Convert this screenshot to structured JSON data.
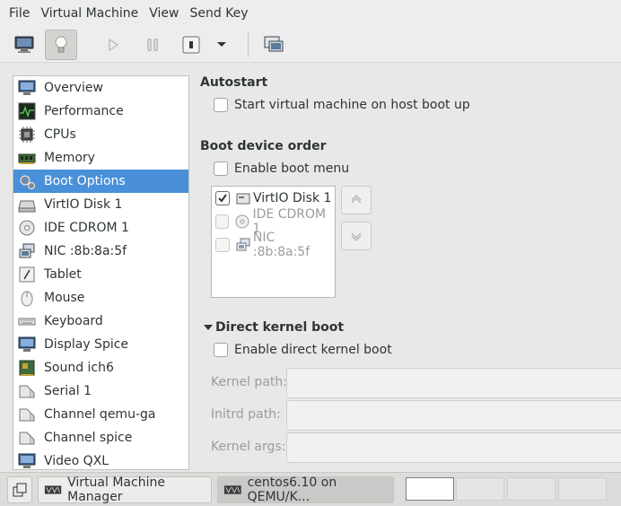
{
  "menubar": {
    "items": [
      "File",
      "Virtual Machine",
      "View",
      "Send Key"
    ]
  },
  "toolbar": {
    "buttons": [
      "monitor-icon",
      "lightbulb-icon",
      "play-icon",
      "pause-icon",
      "shutdown-icon",
      "chevron-down-icon",
      "screenshot-icon"
    ]
  },
  "sidebar": {
    "items": [
      {
        "label": "Overview",
        "icon": "overview-icon"
      },
      {
        "label": "Performance",
        "icon": "performance-icon"
      },
      {
        "label": "CPUs",
        "icon": "cpu-icon"
      },
      {
        "label": "Memory",
        "icon": "memory-icon"
      },
      {
        "label": "Boot Options",
        "icon": "boot-options-icon",
        "selected": true
      },
      {
        "label": "VirtIO Disk 1",
        "icon": "disk-icon"
      },
      {
        "label": "IDE CDROM 1",
        "icon": "cdrom-icon"
      },
      {
        "label": "NIC :8b:8a:5f",
        "icon": "nic-icon"
      },
      {
        "label": "Tablet",
        "icon": "tablet-icon"
      },
      {
        "label": "Mouse",
        "icon": "mouse-icon"
      },
      {
        "label": "Keyboard",
        "icon": "keyboard-icon"
      },
      {
        "label": "Display Spice",
        "icon": "display-icon"
      },
      {
        "label": "Sound ich6",
        "icon": "sound-icon"
      },
      {
        "label": "Serial 1",
        "icon": "serial-icon"
      },
      {
        "label": "Channel qemu-ga",
        "icon": "channel-icon"
      },
      {
        "label": "Channel spice",
        "icon": "channel-icon"
      },
      {
        "label": "Video QXL",
        "icon": "video-icon"
      }
    ]
  },
  "autostart": {
    "title": "Autostart",
    "checkbox_label": "Start virtual machine on host boot up",
    "checked": false
  },
  "boot_order": {
    "title": "Boot device order",
    "menu_label": "Enable boot menu",
    "menu_checked": false,
    "devices": [
      {
        "label": "VirtIO Disk 1",
        "checked": true,
        "enabled": true
      },
      {
        "label": "IDE CDROM 1",
        "checked": false,
        "enabled": false
      },
      {
        "label": "NIC :8b:8a:5f",
        "checked": false,
        "enabled": false
      }
    ]
  },
  "kernel_boot": {
    "title": "Direct kernel boot",
    "checkbox_label": "Enable direct kernel boot",
    "checked": false,
    "fields": [
      {
        "label": "Kernel path:",
        "value": ""
      },
      {
        "label": "Initrd path:",
        "value": ""
      },
      {
        "label": "Kernel args:",
        "value": ""
      }
    ]
  },
  "taskbar": {
    "tasks": [
      {
        "label": "Virtual Machine Manager",
        "active": false
      },
      {
        "label": "centos6.10 on QEMU/K...",
        "active": true
      }
    ],
    "workspaces": 4,
    "active_workspace": 1
  },
  "colors": {
    "selection": "#4a90d9",
    "background": "#e8e8e7"
  }
}
